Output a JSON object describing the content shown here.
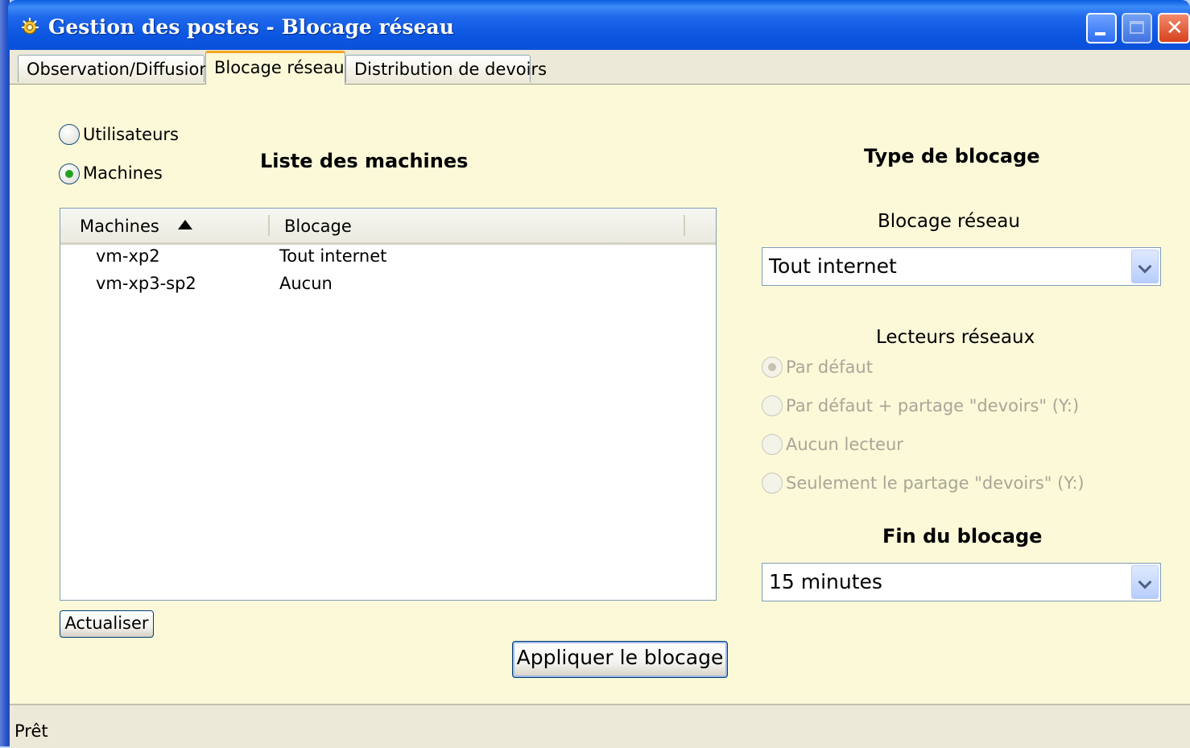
{
  "window": {
    "title": "Gestion des postes - Blocage réseau",
    "controls": [
      "minimize",
      "maximize",
      "close"
    ]
  },
  "tabs": [
    {
      "label": "Observation/Diffusion",
      "active": false
    },
    {
      "label": "Blocage réseau",
      "active": true
    },
    {
      "label": "Distribution de devoirs",
      "active": false
    }
  ],
  "view_mode": {
    "options": [
      {
        "label": "Utilisateurs",
        "selected": false
      },
      {
        "label": "Machines",
        "selected": true
      }
    ]
  },
  "list": {
    "title": "Liste des machines",
    "columns": [
      "Machines",
      "Blocage"
    ],
    "sort": "Machines ascending",
    "rows": [
      {
        "machine": "vm-xp2",
        "blocage": "Tout internet"
      },
      {
        "machine": "vm-xp3-sp2",
        "blocage": "Aucun"
      }
    ],
    "refresh_label": "Actualiser"
  },
  "blocking": {
    "title": "Type de blocage",
    "network_label": "Blocage réseau",
    "network_value": "Tout internet",
    "drives_label": "Lecteurs réseaux",
    "drives_options": [
      {
        "label": "Par défaut",
        "selected": true,
        "enabled": false
      },
      {
        "label": "Par défaut + partage \"devoirs\" (Y:)",
        "selected": false,
        "enabled": false
      },
      {
        "label": "Aucun lecteur",
        "selected": false,
        "enabled": false
      },
      {
        "label": "Seulement le partage \"devoirs\" (Y:)",
        "selected": false,
        "enabled": false
      }
    ],
    "end_title": "Fin du blocage",
    "end_value": "15 minutes"
  },
  "apply_label": "Appliquer le blocage",
  "status": "Prêt",
  "colors": {
    "titlebar": "#0a55e0",
    "client_bg": "#fbf9d8",
    "tab_highlight": "#f6a623",
    "radio_selected": "#21a121"
  }
}
